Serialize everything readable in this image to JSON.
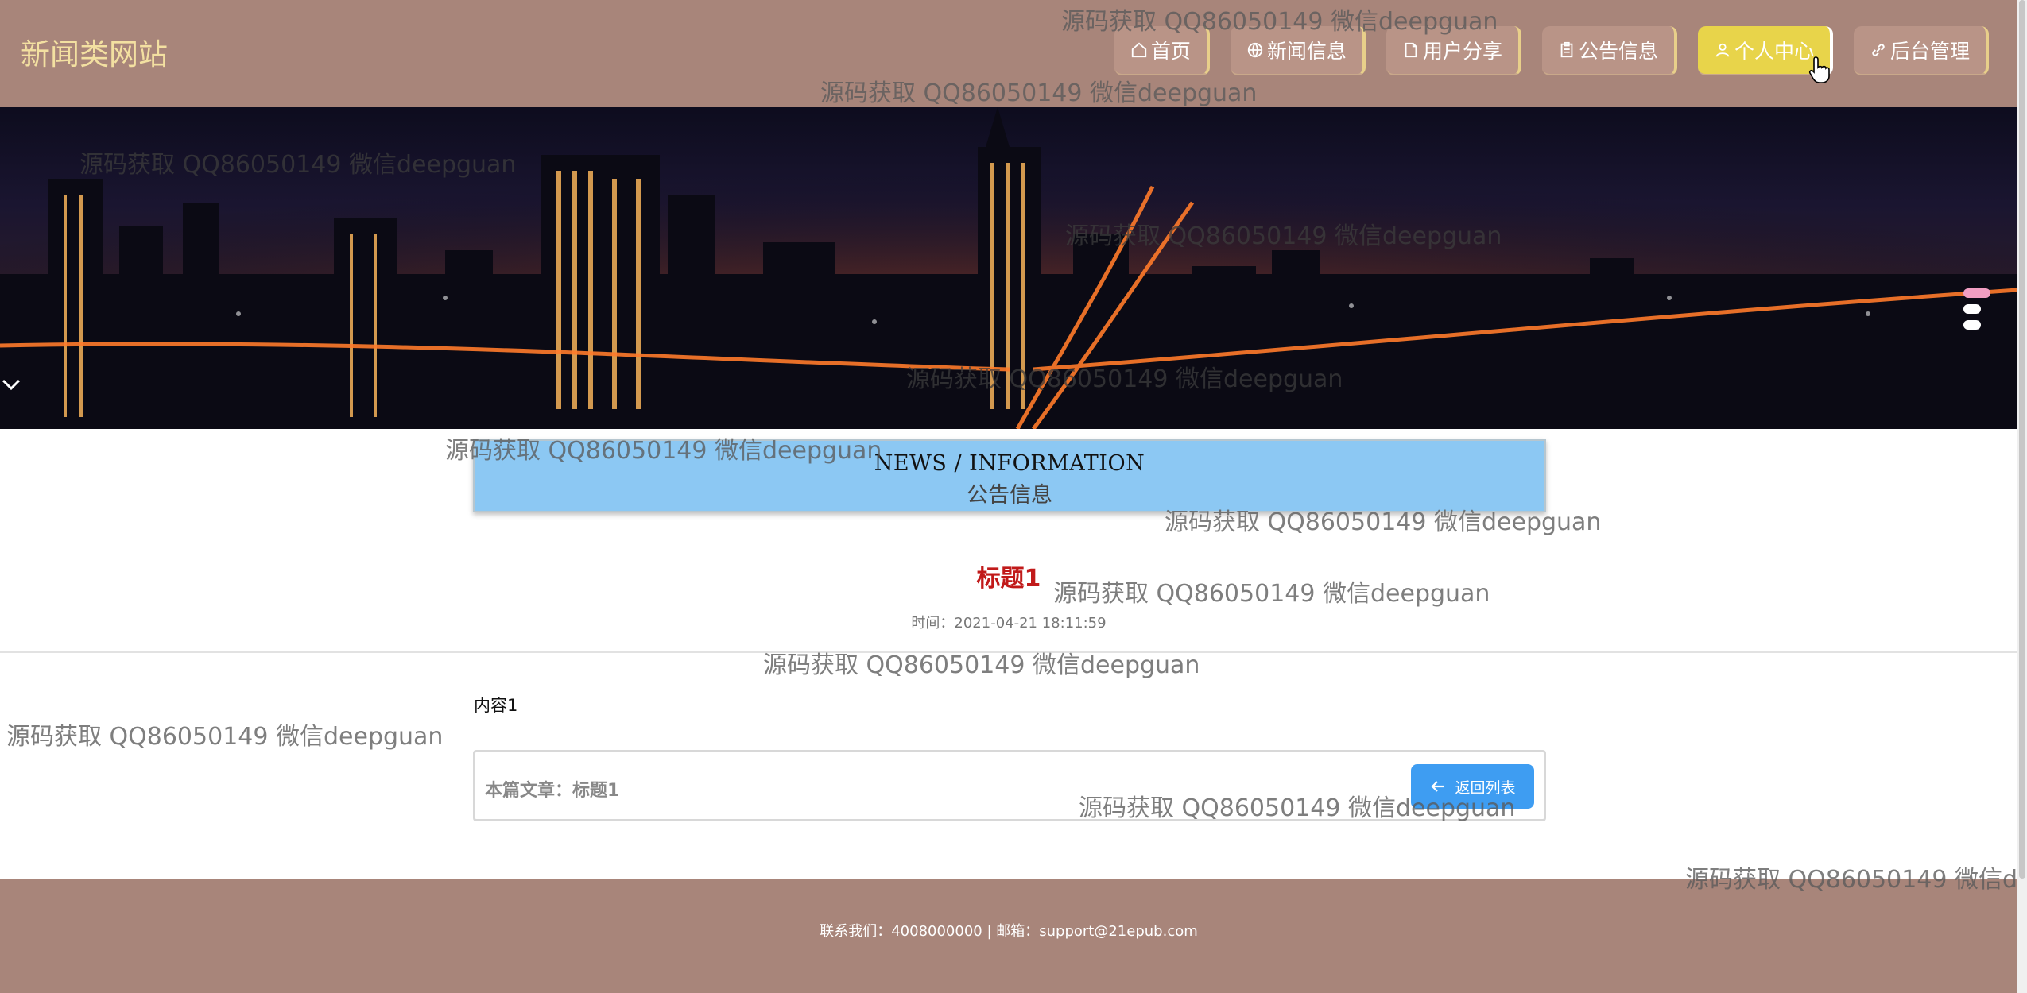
{
  "header": {
    "site_title": "新闻类网站",
    "nav": [
      {
        "label": "首页",
        "icon": "home-icon",
        "active": false
      },
      {
        "label": "新闻信息",
        "icon": "globe-icon",
        "active": false
      },
      {
        "label": "用户分享",
        "icon": "share-doc-icon",
        "active": false
      },
      {
        "label": "公告信息",
        "icon": "clipboard-icon",
        "active": false
      },
      {
        "label": "个人中心",
        "icon": "user-icon",
        "active": true
      },
      {
        "label": "后台管理",
        "icon": "link-icon",
        "active": false
      }
    ]
  },
  "banner": {
    "slides": 3,
    "active_slide": 0
  },
  "section": {
    "title_en": "NEWS / INFORMATION",
    "title_cn": "公告信息"
  },
  "article": {
    "title": "标题1",
    "time": "时间：2021-04-21 18:11:59",
    "content": "内容1",
    "current_label": "本篇文章：标题1",
    "back_label": "返回列表"
  },
  "footer": {
    "contact": "联系我们：4008000000 | 邮箱：support@21epub.com"
  },
  "watermark": "源码获取 QQ86050149 微信deepguan",
  "colors": {
    "header_bg": "#a8857a",
    "title_yellow": "#f3e0a1",
    "active_nav": "#e8d44a",
    "section_blue": "#8cc8f3",
    "article_red": "#c11a1a",
    "button_blue": "#3e9df2"
  }
}
